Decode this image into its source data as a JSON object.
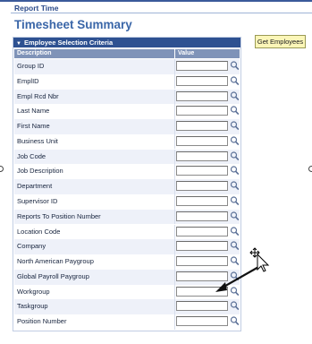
{
  "breadcrumb": "Report Time",
  "page_title": "Timesheet Summary",
  "panel": {
    "header": "Employee Selection Criteria",
    "col_description": "Description",
    "col_value": "Value"
  },
  "get_employees_label": "Get Employees",
  "fields": [
    {
      "label": "Group ID",
      "value": ""
    },
    {
      "label": "EmplID",
      "value": ""
    },
    {
      "label": "Empl Rcd Nbr",
      "value": ""
    },
    {
      "label": "Last Name",
      "value": ""
    },
    {
      "label": "First Name",
      "value": ""
    },
    {
      "label": "Business Unit",
      "value": ""
    },
    {
      "label": "Job Code",
      "value": ""
    },
    {
      "label": "Job Description",
      "value": ""
    },
    {
      "label": "Department",
      "value": ""
    },
    {
      "label": "Supervisor ID",
      "value": ""
    },
    {
      "label": "Reports To Position Number",
      "value": ""
    },
    {
      "label": "Location Code",
      "value": ""
    },
    {
      "label": "Company",
      "value": ""
    },
    {
      "label": "North American Paygroup",
      "value": ""
    },
    {
      "label": "Global Payroll Paygroup",
      "value": ""
    },
    {
      "label": "Workgroup",
      "value": ""
    },
    {
      "label": "Taskgroup",
      "value": ""
    },
    {
      "label": "Position Number",
      "value": ""
    }
  ],
  "icons": {
    "lookup": "magnifier-icon",
    "collapse": "triangle-down-icon",
    "cursor": "move-cursor-icon",
    "annotation": "arrow-icon"
  },
  "colors": {
    "accent": "#2e5191",
    "title": "#3a66a8",
    "button": "#fbf6b8"
  }
}
